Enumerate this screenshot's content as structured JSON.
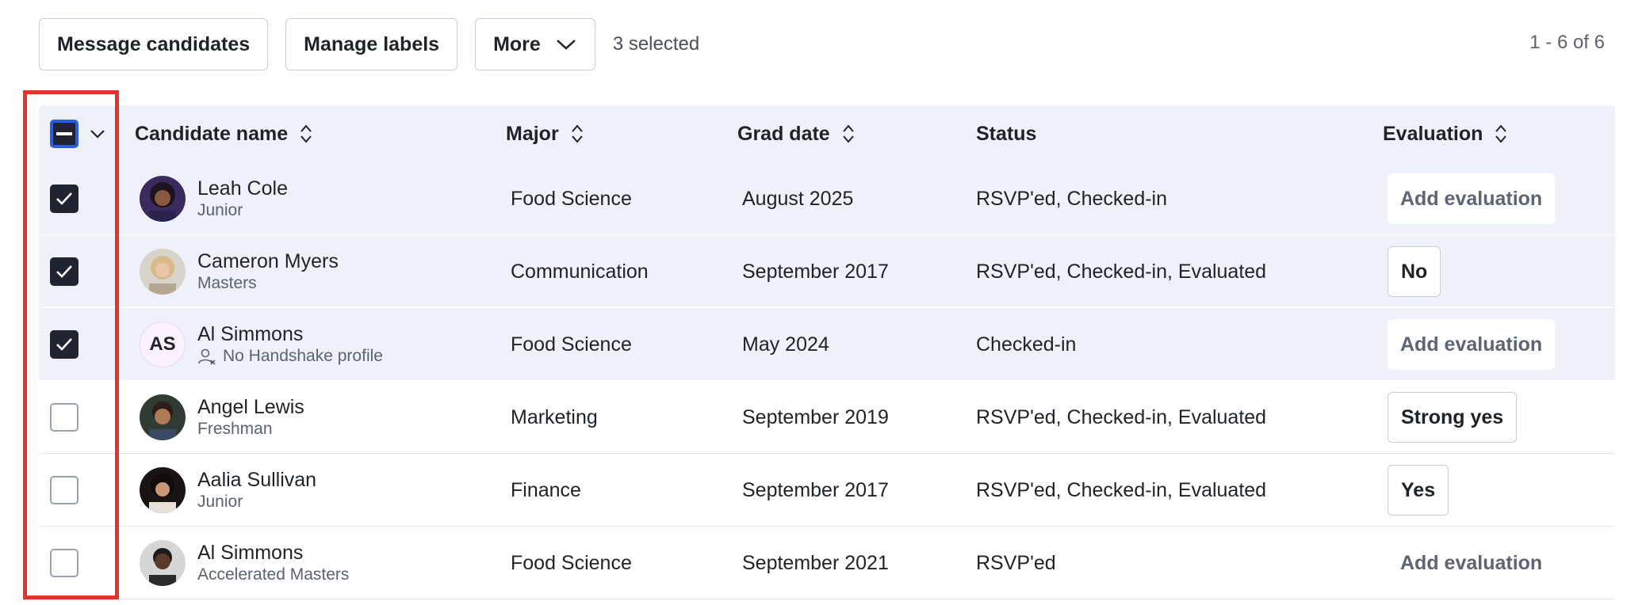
{
  "toolbar": {
    "message_label": "Message candidates",
    "labels_label": "Manage labels",
    "more_label": "More",
    "selected_text": "3 selected"
  },
  "pagination": {
    "range": "1 - 6 of 6"
  },
  "table": {
    "columns": {
      "name": "Candidate name",
      "major": "Major",
      "grad": "Grad date",
      "status": "Status",
      "evaluation": "Evaluation"
    },
    "rows": [
      {
        "name": "Leah Cole",
        "sub": "Junior",
        "major": "Food Science",
        "grad": "August 2025",
        "status": "RSVP'ed, Checked-in",
        "evaluation": "Add evaluation",
        "checked": true
      },
      {
        "name": "Cameron Myers",
        "sub": "Masters",
        "major": "Communication",
        "grad": "September 2017",
        "status": "RSVP'ed, Checked-in, Evaluated",
        "evaluation": "No",
        "checked": true
      },
      {
        "name": "Al Simmons",
        "sub": "No Handshake profile",
        "initials": "AS",
        "major": "Food Science",
        "grad": "May 2024",
        "status": "Checked-in",
        "evaluation": "Add evaluation",
        "checked": true
      },
      {
        "name": "Angel Lewis",
        "sub": "Freshman",
        "major": "Marketing",
        "grad": "September 2019",
        "status": "RSVP'ed, Checked-in, Evaluated",
        "evaluation": "Strong yes",
        "checked": false
      },
      {
        "name": "Aalia Sullivan",
        "sub": "Junior",
        "major": "Finance",
        "grad": "September 2017",
        "status": "RSVP'ed, Checked-in, Evaluated",
        "evaluation": "Yes",
        "checked": false
      },
      {
        "name": "Al Simmons",
        "sub": "Accelerated Masters",
        "major": "Food Science",
        "grad": "September 2021",
        "status": "RSVP'ed",
        "evaluation": "Add evaluation",
        "checked": false
      }
    ]
  },
  "colors": {
    "selected_row_bg": "#eef1f9",
    "checkbox_checked": "#1f2430",
    "highlight_border": "#e0352b"
  }
}
